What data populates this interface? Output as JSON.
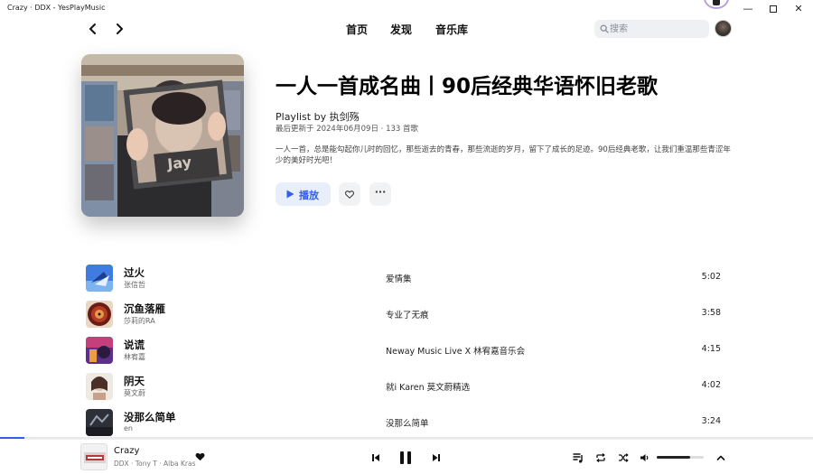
{
  "window": {
    "title": "Crazy · DDX - YesPlayMusic",
    "minimize_label": "—",
    "close_label": "✕"
  },
  "nav": {
    "back_icon": "chevron-left-icon",
    "forward_icon": "chevron-right-icon",
    "links": [
      "首页",
      "发现",
      "音乐库"
    ],
    "search_placeholder": "搜索"
  },
  "playlist": {
    "title": "一人一首成名曲丨90后经典华语怀旧老歌",
    "by": "Playlist by 执剑殇",
    "meta": "最后更新于 2024年06月09日 · 133 首歌",
    "description": "一人一首，总是能勾起你儿时的回忆，那些逝去的青春，那些流逝的岁月，留下了成长的足迹。90后经典老歌，让我们重温那些青涩年少的美好时光吧！",
    "play_label": "播放",
    "more_label": "···",
    "accent_color": "#335eea"
  },
  "tracks": [
    {
      "name": "过火",
      "artist": "张信哲",
      "album": "爱情集",
      "duration": "5:02"
    },
    {
      "name": "沉鱼落雁",
      "artist": "莎莉的RA",
      "album": "专业了无痕",
      "duration": "3:58"
    },
    {
      "name": "说谎",
      "artist": "林宥嘉",
      "album": "Neway Music Live X 林宥嘉音乐会",
      "duration": "4:15"
    },
    {
      "name": "阴天",
      "artist": "莫文蔚",
      "album": "就i Karen 莫文蔚精选",
      "duration": "4:02"
    },
    {
      "name": "没那么简单",
      "artist": "en",
      "album": "没那么简单",
      "duration": "3:24"
    }
  ],
  "player": {
    "song": "Crazy",
    "artist": "DDX · Tony T · Alba Kras",
    "progress_fraction": 0.03,
    "volume_fraction": 0.72
  }
}
